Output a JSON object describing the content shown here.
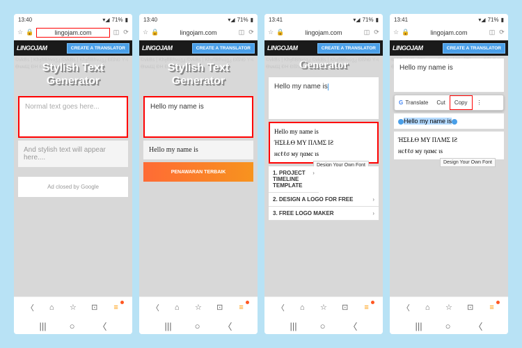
{
  "status": {
    "signal": "📶",
    "wifi": "📡",
    "batt_icon": "🔋"
  },
  "url": {
    "domain": "lingojam.com"
  },
  "brand": {
    "logo": "LINGOJAM",
    "cta": "CREATE A TRANSLATOR"
  },
  "hero": {
    "line1": "Stylish Text",
    "line2": "Generator",
    "single": "Generator"
  },
  "p1": {
    "time": "13:40",
    "batt": "71%",
    "input_ph": "Normal text goes here...",
    "output_ph": "And stylish text will appear here....",
    "ad": "Ad closed by Google"
  },
  "p2": {
    "time": "13:40",
    "batt": "71%",
    "input": "Hello my name is",
    "result": "Hello my name is",
    "banner": "PENAWARAN TERBAIK"
  },
  "p3": {
    "time": "13:41",
    "batt": "71%",
    "input": "Hello my name is",
    "results": [
      "Hello my name is",
      "ΉΣŁŁӨ MY ПΛMΣ IƧ",
      "нєℓℓσ му ηαмє ιѕ"
    ],
    "dof": "Design Your Own Font",
    "ads": [
      "PROJECT TIMELINE TEMPLATE",
      "DESIGN A LOGO FOR FREE",
      "FREE LOGO MAKER"
    ]
  },
  "p4": {
    "time": "13:41",
    "batt": "71%",
    "input": "Hello my name is",
    "ctx": {
      "translate": "Translate",
      "cut": "Cut",
      "copy": "Copy"
    },
    "sel": "Hello my name is",
    "results": [
      "ΉΣŁŁӨ MY ПΛMΣ IƧ",
      "нєℓℓσ му ηαмє ιѕ"
    ],
    "dof": "Design Your Own Font"
  },
  "bg": "©vkBs | KhჯfIBhvაჳკ ©vkBs | KhჯfIBhvაჳკ ĐßhĐ YএӨѡผЩ ĐH ĐßhĐ YএӨѡผЩ"
}
